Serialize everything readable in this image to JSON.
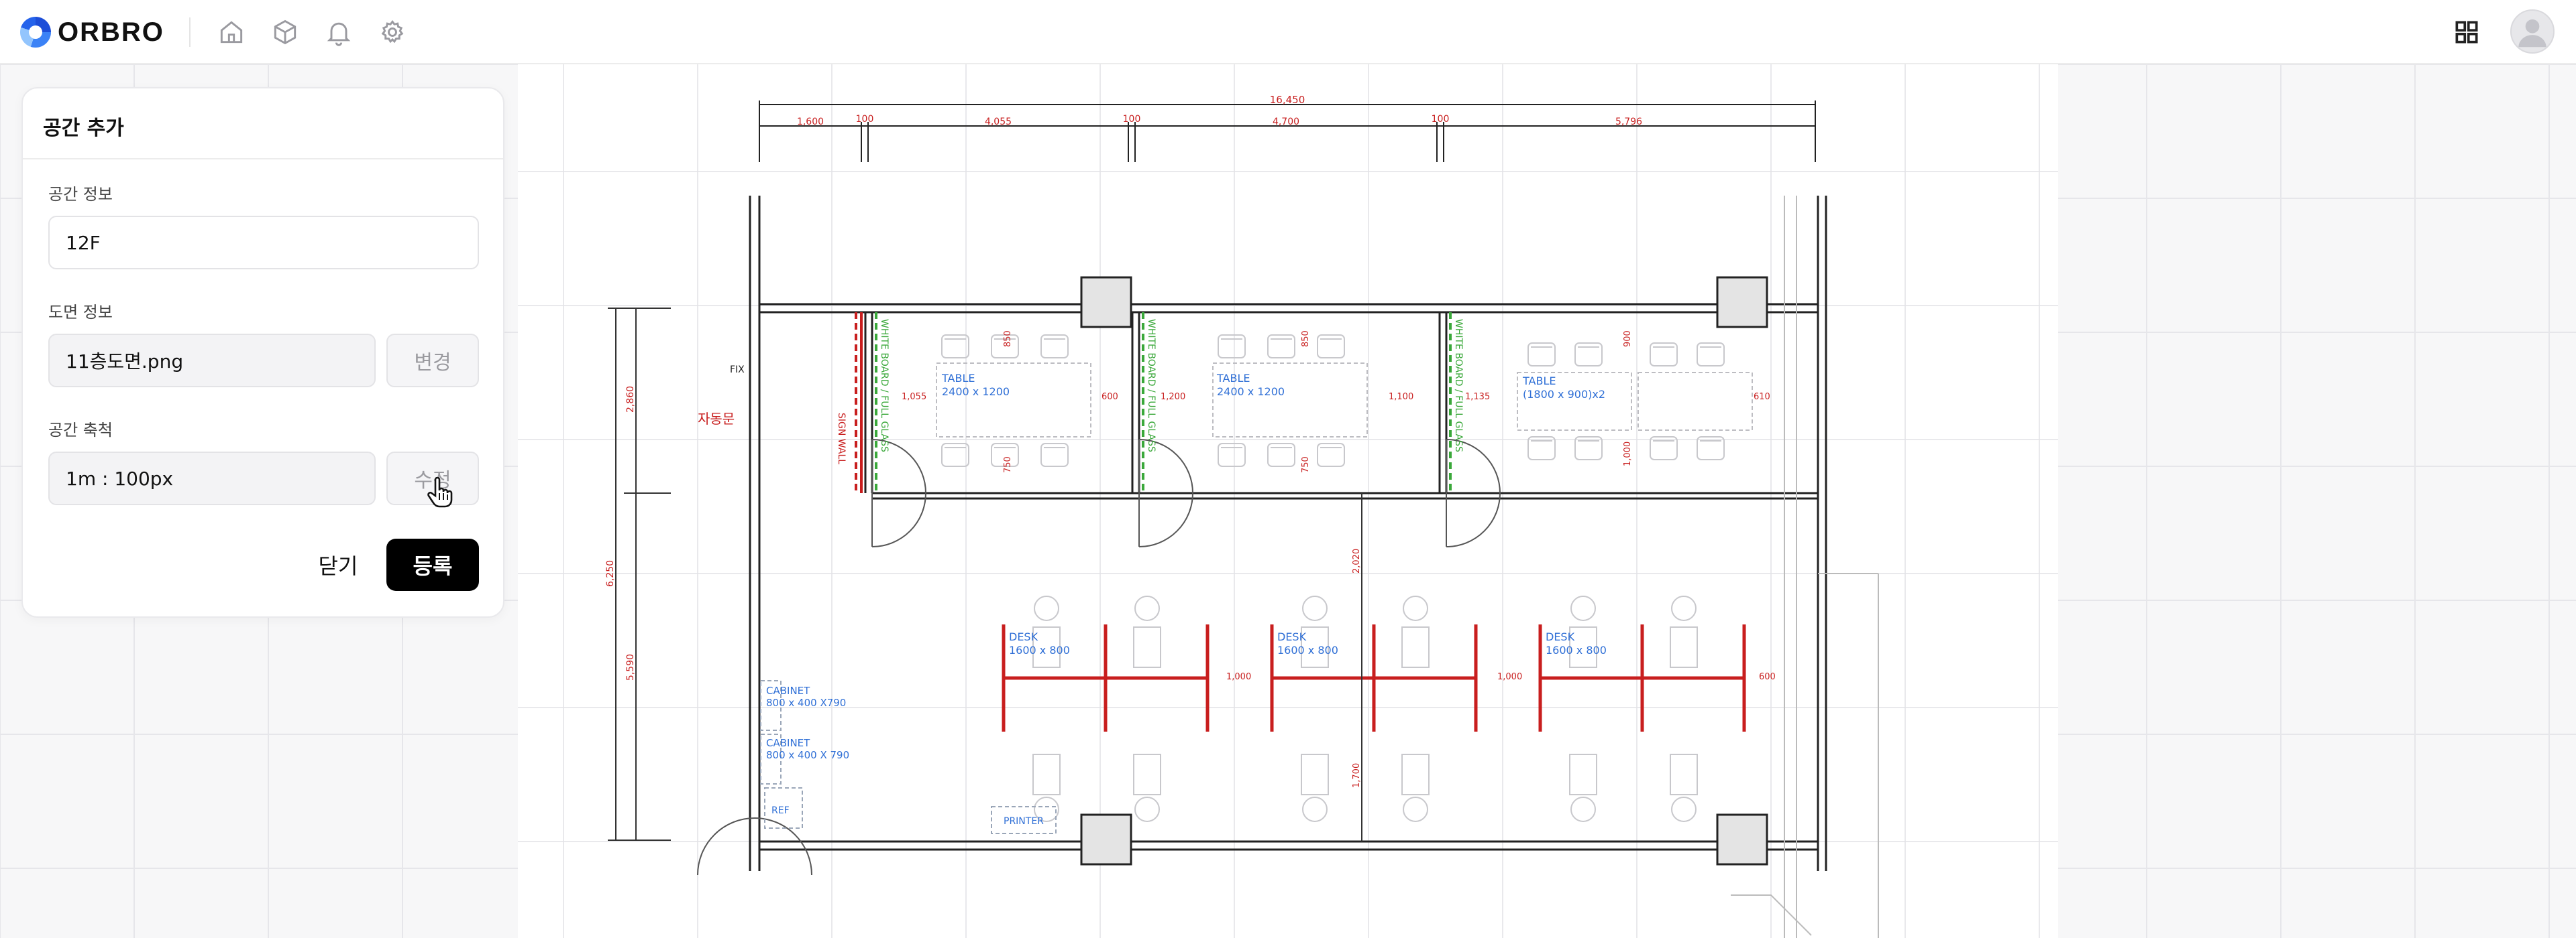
{
  "brand": {
    "name": "ORBRO"
  },
  "header": {
    "nav_icons": [
      "home-icon",
      "cube-icon",
      "bell-icon",
      "gear-icon"
    ],
    "right_icons": [
      "apps-grid-icon",
      "user-avatar-icon"
    ]
  },
  "panel": {
    "title": "공간 추가",
    "space_info_label": "공간 정보",
    "space_info_value": "12F",
    "drawing_label": "도면 정보",
    "drawing_value": "11층도면.png",
    "drawing_change": "변경",
    "scale_label": "공간 축척",
    "scale_value": "1m : 100px",
    "scale_edit": "수정",
    "close": "닫기",
    "submit": "등록"
  },
  "floorplan": {
    "dims_top_total": "16,450",
    "dims_top": [
      "1,600",
      "100",
      "4,055",
      "100",
      "4,700",
      "100",
      "5,796"
    ],
    "dims_left": [
      "2,860",
      "6,250",
      "5,590"
    ],
    "labels": {
      "fix": "FIX",
      "door": "자동문",
      "sign_wall": "SIGN WALL",
      "white_board": "WHITE BOARD / FULL GLASS",
      "table1": "TABLE",
      "table1_size": "2400 x 1200",
      "table2": "TABLE",
      "table2_size": "2400 x 1200",
      "table3": "TABLE",
      "table3_size": "(1800 x 900)x2",
      "desk": "DESK",
      "desk_size": "1600 x 800",
      "cabinet": "CABINET",
      "cabinet_size": "800 x 400 X790",
      "cabinet2_size": "800 x 400 X 790",
      "ref": "REF",
      "printer": "PRINTER"
    },
    "inner_dims": [
      "1,055",
      "600",
      "1,200",
      "1,100",
      "1,135",
      "610",
      "850",
      "750",
      "850",
      "750",
      "900",
      "1,000",
      "2,020",
      "1,700",
      "1,000",
      "1,000",
      "600"
    ]
  },
  "colors": {
    "accent_red": "#c81e1e",
    "glass_green": "#3aa83a",
    "label_blue": "#2f6fd6",
    "button_black": "#000000"
  }
}
